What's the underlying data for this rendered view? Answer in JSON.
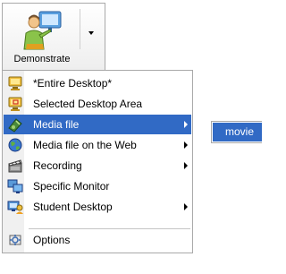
{
  "toolbar": {
    "demonstrate_label": "Demonstrate",
    "demonstrate_icon": "presenter-icon"
  },
  "menu": {
    "items": [
      {
        "label": "*Entire Desktop*",
        "icon": "monitor-icon",
        "submenu": false
      },
      {
        "label": "Selected Desktop Area",
        "icon": "monitor-area-icon",
        "submenu": false
      },
      {
        "label": "Media file",
        "icon": "media-file-icon",
        "submenu": true,
        "selected": true
      },
      {
        "label": "Media file on the Web",
        "icon": "web-globe-icon",
        "submenu": true
      },
      {
        "label": "Recording",
        "icon": "clapperboard-icon",
        "submenu": true
      },
      {
        "label": "Specific Monitor",
        "icon": "multiple-monitors-icon",
        "submenu": false
      },
      {
        "label": "Student Desktop",
        "icon": "student-desktop-icon",
        "submenu": true
      },
      {
        "label": "Options",
        "icon": "options-icon",
        "submenu": false
      }
    ]
  },
  "submenu": {
    "items": [
      {
        "label": "movie",
        "selected": true
      }
    ]
  },
  "colors": {
    "highlight": "#316ac5",
    "menu_border": "#a9a9a9",
    "gutter": "#f0f0f0"
  }
}
